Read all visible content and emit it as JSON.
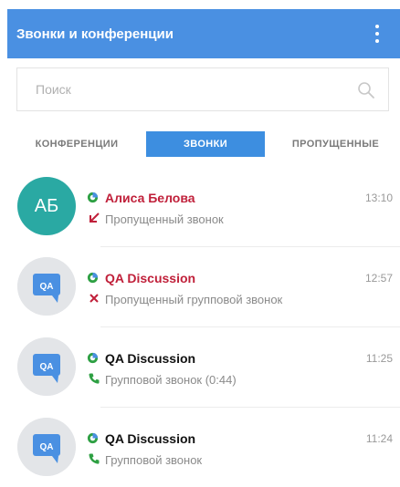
{
  "header": {
    "title": "Звонки и конференции",
    "menu_icon": "vertical-dots-icon"
  },
  "search": {
    "placeholder": "Поиск",
    "value": "",
    "icon": "search-icon"
  },
  "tabs": [
    {
      "label": "КОНФЕРЕНЦИИ",
      "active": false
    },
    {
      "label": "ЗВОНКИ",
      "active": true
    },
    {
      "label": "ПРОПУЩЕННЫЕ",
      "active": false
    }
  ],
  "calls": [
    {
      "avatar": "АБ",
      "name": "Алиса Белова",
      "time": "13:10",
      "status": "Пропущенный звонок",
      "missed": true,
      "icon": "missed-call-arrow-icon"
    },
    {
      "avatar": "QA",
      "name": "QA Discussion",
      "time": "12:57",
      "status": "Пропущенный групповой звонок",
      "missed": true,
      "icon": "missed-group-call-x-icon"
    },
    {
      "avatar": "QA",
      "name": "QA Discussion",
      "time": "11:25",
      "status": "Групповой звонок (0:44)",
      "missed": false,
      "icon": "phone-icon"
    },
    {
      "avatar": "QA",
      "name": "QA Discussion",
      "time": "11:24",
      "status": "Групповой звонок",
      "missed": false,
      "icon": "phone-icon"
    }
  ],
  "colors": {
    "header": "#4a90e2",
    "active_tab": "#3d8ee0",
    "missed": "#c0203a",
    "ok": "#2ea043",
    "avatar_user": "#2aa9a3"
  }
}
